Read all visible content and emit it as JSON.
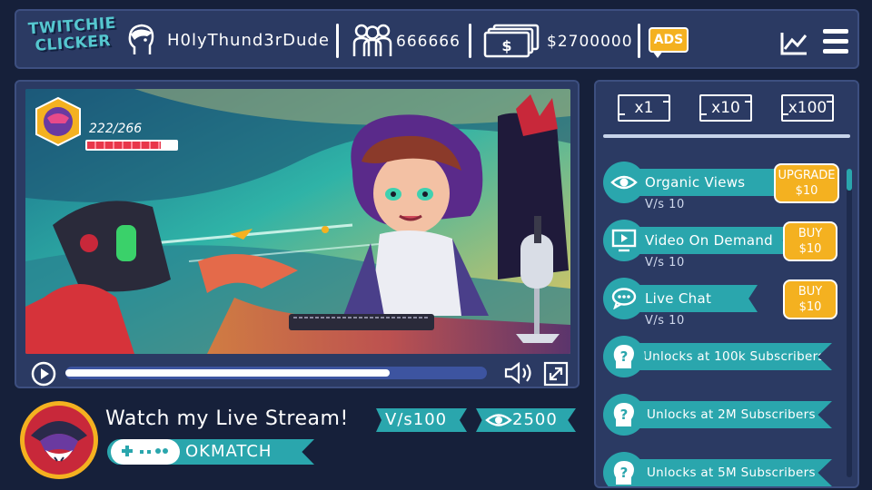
{
  "header": {
    "logo_line1": "TWITCHIE",
    "logo_line2": "CLICKER",
    "username": "H0lyThund3rDude",
    "subscribers": "666666",
    "money": "$2700000",
    "ads_label": "ADS",
    "icons": [
      "user-head-icon",
      "subscribers-icon",
      "money-icon",
      "stats-chart-icon",
      "menu-icon"
    ]
  },
  "video": {
    "hp_text": "222/266",
    "hp_fraction": 0.83,
    "progress_fraction": 0.77
  },
  "stream": {
    "title": "Watch my Live Stream!",
    "views_per_second": "V/s100",
    "viewers": "2500",
    "game_name": "OKMATCH"
  },
  "multipliers": [
    "x1",
    "x10",
    "x100"
  ],
  "upgrades": [
    {
      "name": "Organic Views",
      "rate": "V/s 10",
      "action_line1": "UPGRADE",
      "action_line2": "$10",
      "icon": "eye-icon"
    },
    {
      "name": "Video On Demand",
      "rate": "V/s 10",
      "action_line1": "BUY",
      "action_line2": "$10",
      "icon": "video-icon"
    },
    {
      "name": "Live Chat",
      "rate": "V/s 10",
      "action_line1": "BUY",
      "action_line2": "$10",
      "icon": "chat-icon"
    }
  ],
  "locked": [
    {
      "label": "Unlocks at 100k Subscribers",
      "icon": "lock-question-icon"
    },
    {
      "label": "Unlocks at 2M Subscribers",
      "icon": "lock-question-icon"
    },
    {
      "label": "Unlocks at 5M Subscribers",
      "icon": "lock-question-icon"
    }
  ],
  "colors": {
    "background": "#16203a",
    "panel": "#2b3a63",
    "teal": "#2aa6ad",
    "gold": "#f4b120"
  }
}
